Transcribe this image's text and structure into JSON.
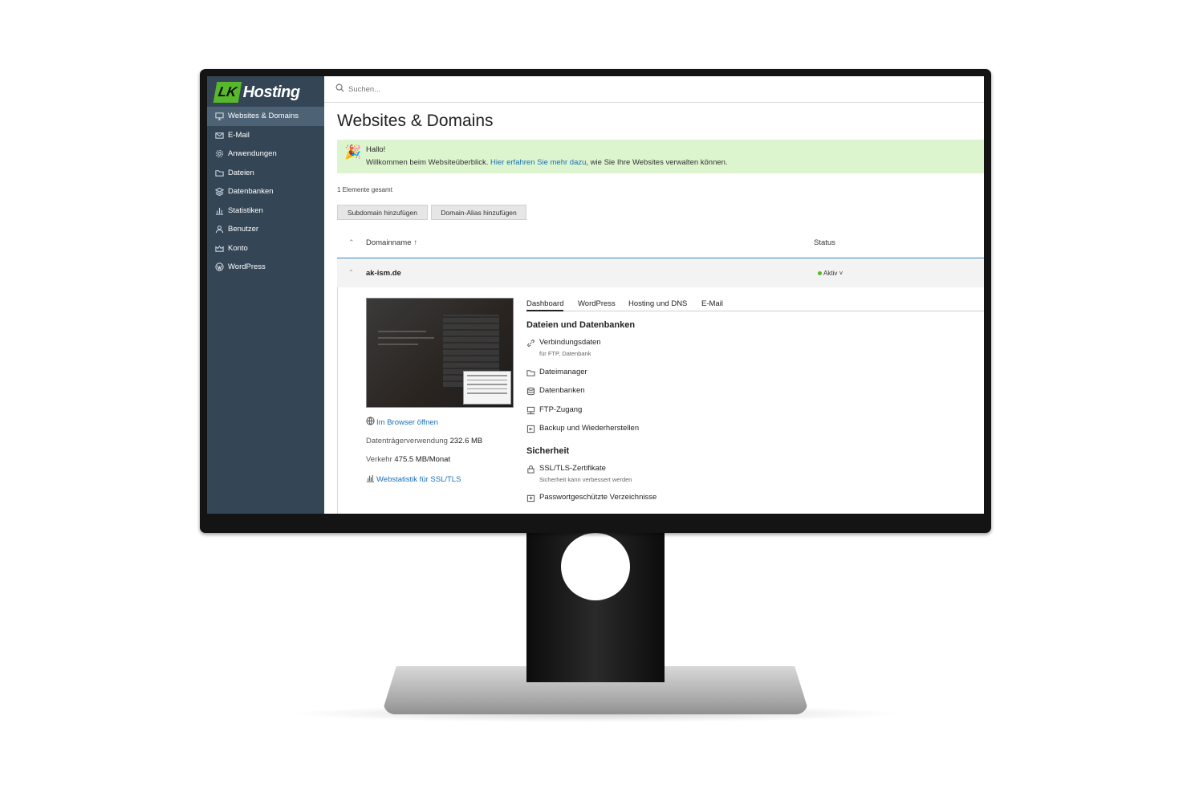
{
  "sidebar": {
    "logo_badge": "LK",
    "logo_text": "Hosting",
    "items": [
      {
        "label": "Websites & Domains",
        "icon": "monitor-icon",
        "active": true
      },
      {
        "label": "E-Mail",
        "icon": "mail-icon"
      },
      {
        "label": "Anwendungen",
        "icon": "gear-icon"
      },
      {
        "label": "Dateien",
        "icon": "folder-icon"
      },
      {
        "label": "Datenbanken",
        "icon": "database-icon"
      },
      {
        "label": "Statistiken",
        "icon": "bar-chart-icon"
      },
      {
        "label": "Benutzer",
        "icon": "user-icon"
      },
      {
        "label": "Konto",
        "icon": "account-icon"
      },
      {
        "label": "WordPress",
        "icon": "wordpress-icon"
      }
    ]
  },
  "search": {
    "placeholder": "Suchen..."
  },
  "page": {
    "title": "Websites & Domains"
  },
  "welcome": {
    "title": "Hallo!",
    "text_before": "Willkommen beim Websiteüberblick. ",
    "link": "Hier erfahren Sie mehr dazu",
    "text_after": ", wie Sie Ihre Websites verwalten können."
  },
  "list": {
    "count": "1 Elemente gesamt",
    "buttons": {
      "subdomain": "Subdomain hinzufügen",
      "alias": "Domain-Alias hinzufügen"
    },
    "columns": {
      "name": "Domainname",
      "sort": "↑",
      "status": "Status"
    },
    "rows": [
      {
        "domain": "ak-ism.de",
        "status": "Aktiv"
      }
    ]
  },
  "detail": {
    "open_browser": "Im Browser öffnen",
    "disk_label": "Datenträgerverwendung",
    "disk_value": "232.6 MB",
    "traffic_label": "Verkehr",
    "traffic_value": "475.5 MB/Monat",
    "webstat": "Webstatistik für SSL/TLS",
    "tabs": [
      "Dashboard",
      "WordPress",
      "Hosting und DNS",
      "E-Mail"
    ],
    "sections": {
      "files": "Dateien und Datenbanken",
      "security": "Sicherheit"
    },
    "links": {
      "connection": "Verbindungsdaten",
      "connection_sub": "für FTP, Datenbank",
      "filemanager": "Dateimanager",
      "databases": "Datenbanken",
      "ftp": "FTP-Zugang",
      "backup": "Backup und Wiederherstellen",
      "ssl": "SSL/TLS-Zertifikate",
      "ssl_sub": "Sicherheit kann verbessert werden",
      "protected": "Passwortgeschützte Verzeichnisse"
    }
  },
  "colors": {
    "sidebar": "#344656",
    "accent": "#57b82b",
    "link": "#1a6fb4",
    "welcome_bg": "#ddf5cf"
  }
}
